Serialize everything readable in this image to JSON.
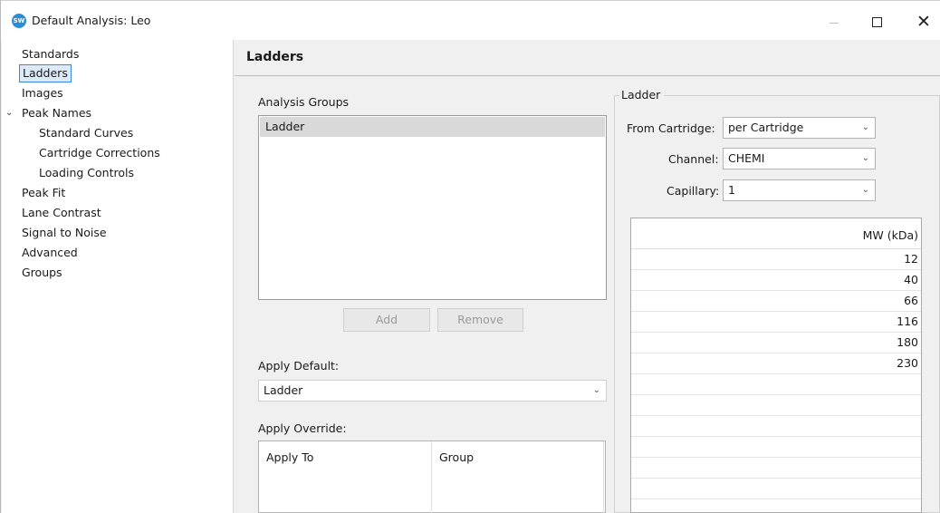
{
  "window": {
    "title": "Default Analysis: Leo",
    "icon_label": "SW",
    "close_glyph": "✕"
  },
  "sidebar": {
    "items": [
      {
        "label": "Standards",
        "level": 0
      },
      {
        "label": "Ladders",
        "level": 0,
        "selected": true
      },
      {
        "label": "Images",
        "level": 0
      },
      {
        "label": "Peak Names",
        "level": 0,
        "expanded": true
      },
      {
        "label": "Standard Curves",
        "level": 1
      },
      {
        "label": "Cartridge Corrections",
        "level": 1
      },
      {
        "label": "Loading Controls",
        "level": 1
      },
      {
        "label": "Peak Fit",
        "level": 0
      },
      {
        "label": "Lane Contrast",
        "level": 0
      },
      {
        "label": "Signal to Noise",
        "level": 0
      },
      {
        "label": "Advanced",
        "level": 0
      },
      {
        "label": "Groups",
        "level": 0
      }
    ],
    "expand_glyph": "⌄"
  },
  "header": {
    "title": "Ladders"
  },
  "analysis_groups": {
    "label": "Analysis Groups",
    "items": [
      "Ladder"
    ],
    "add_label": "Add",
    "remove_label": "Remove"
  },
  "apply_default": {
    "label": "Apply Default:",
    "value": "Ladder"
  },
  "apply_override": {
    "label": "Apply Override:",
    "columns": [
      "Apply To",
      "Group"
    ]
  },
  "ladder": {
    "group_title": "Ladder",
    "from_cartridge": {
      "label": "From Cartridge:",
      "value": "per Cartridge"
    },
    "channel": {
      "label": "Channel:",
      "value": "CHEMI"
    },
    "capillary": {
      "label": "Capillary:",
      "value": "1"
    },
    "table": {
      "header": "MW (kDa)",
      "values": [
        "12",
        "40",
        "66",
        "116",
        "180",
        "230"
      ]
    }
  },
  "icons": {
    "dropdown_arrow": "⌄",
    "colors": {
      "selection_border": "#3c8ad6",
      "selection_fill": "#dbe9f9",
      "app_icon": "#2a8fd6"
    }
  }
}
